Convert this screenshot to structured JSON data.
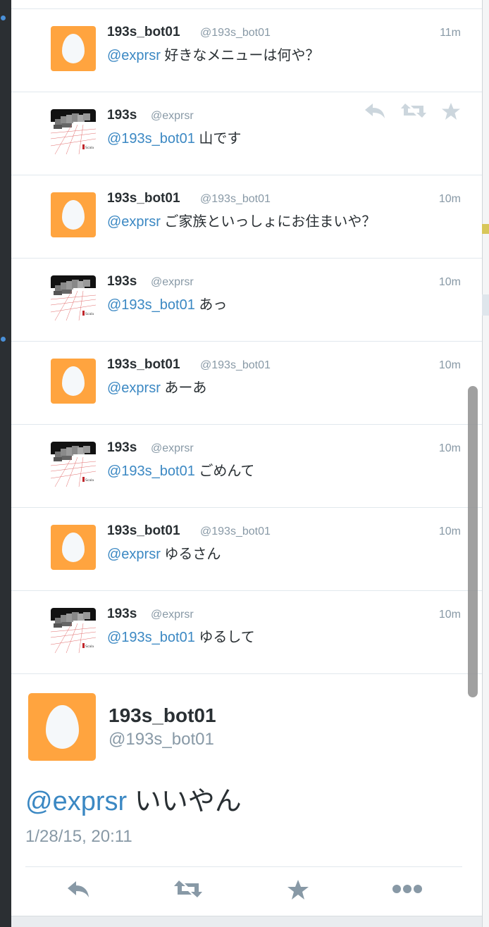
{
  "timeline": {
    "tweets": [
      {
        "name": "193s_bot01",
        "handle": "@193s_bot01",
        "time": "11m",
        "mention": "@exprsr",
        "text": " 好きなメニューは何や？",
        "avatar": "egg"
      },
      {
        "name": "193s",
        "handle": "@exprsr",
        "time": "",
        "mention": "@193s_bot01",
        "text": " 山です",
        "avatar": "scala",
        "hover_actions": true
      },
      {
        "name": "193s_bot01",
        "handle": "@193s_bot01",
        "time": "10m",
        "mention": "@exprsr",
        "text": " ご家族といっしょにお住まいや？",
        "avatar": "egg"
      },
      {
        "name": "193s",
        "handle": "@exprsr",
        "time": "10m",
        "mention": "@193s_bot01",
        "text": " あっ",
        "avatar": "scala"
      },
      {
        "name": "193s_bot01",
        "handle": "@193s_bot01",
        "time": "10m",
        "mention": "@exprsr",
        "text": " あーあ",
        "avatar": "egg"
      },
      {
        "name": "193s",
        "handle": "@exprsr",
        "time": "10m",
        "mention": "@193s_bot01",
        "text": " ごめんて",
        "avatar": "scala"
      },
      {
        "name": "193s_bot01",
        "handle": "@193s_bot01",
        "time": "10m",
        "mention": "@exprsr",
        "text": " ゆるさん",
        "avatar": "egg"
      },
      {
        "name": "193s",
        "handle": "@exprsr",
        "time": "10m",
        "mention": "@193s_bot01",
        "text": " ゆるして",
        "avatar": "scala"
      }
    ]
  },
  "detail": {
    "name": "193s_bot01",
    "handle": "@193s_bot01",
    "mention": "@exprsr",
    "text": " いいやん",
    "timestamp": "1/28/15, 20:11"
  },
  "icons": {
    "reply": "reply-icon",
    "retweet": "retweet-icon",
    "favorite": "star-icon",
    "more": "more-icon"
  },
  "colors": {
    "egg_avatar": "#ffa43f",
    "mention": "#3b88c3",
    "muted": "#8899a6",
    "action_icon": "#8899a6",
    "hover_icon": "#ccd6dd"
  }
}
